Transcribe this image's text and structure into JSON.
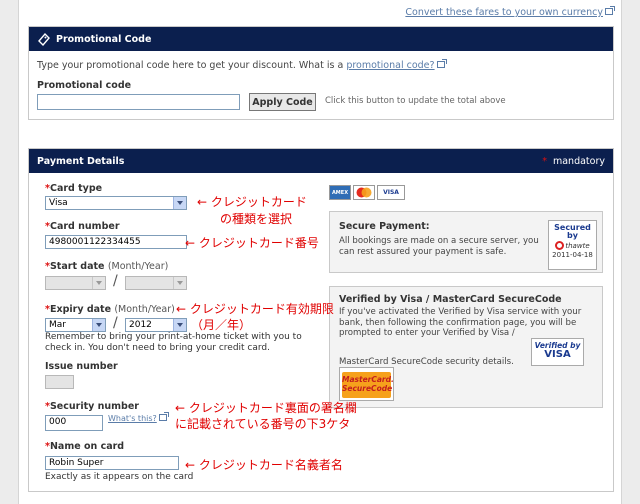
{
  "top_link": "Convert these fares to your own currency",
  "promo": {
    "title": "Promotional Code",
    "intro": "Type your promotional code here to get your discount. What is a",
    "intro_link": "promotional code?",
    "field_label": "Promotional code",
    "field_value": "",
    "apply_button": "Apply Code",
    "hint": "Click this button to update the total above"
  },
  "payment": {
    "title": "Payment Details",
    "mandatory_star": "*",
    "mandatory": "mandatory",
    "req_star": "*",
    "card_type_label": "Card type",
    "card_type_value": "Visa",
    "card_number_label": "Card number",
    "card_number_value": "4980001122334455",
    "start_date_label": "Start date",
    "start_date_hint": "(Month/Year)",
    "start_month": "",
    "start_year": "",
    "date_sep": "/",
    "expiry_label": "Expiry date",
    "expiry_hint": "(Month/Year)",
    "expiry_month": "Mar",
    "expiry_year": "2012",
    "reminder": "Remember to bring your print-at-home ticket with you to check in. You don't need to bring your credit card.",
    "issue_label": "Issue number",
    "issue_value": "",
    "security_label": "Security number",
    "security_value": "000",
    "whats_this": "What's this?",
    "name_label": "Name on card",
    "name_value": "Robin Super",
    "name_hint": "Exactly as it appears on the card",
    "card_logos": [
      "AMEX",
      "MC",
      "VISA"
    ]
  },
  "secure": {
    "title": "Secure Payment:",
    "text": "All bookings are made on a secure server, you can rest assured your payment is safe.",
    "badge_line1": "Secured",
    "badge_line2": "by",
    "badge_brand": "thawte",
    "badge_date": "2011-04-18"
  },
  "verified": {
    "title": "Verified by Visa / MasterCard SecureCode",
    "text": "If you've activated the Verified by Visa service with your bank, then following the confirmation page, you will be prompted to enter your Verified by Visa /",
    "text2": "MasterCard SecureCode security details.",
    "vbv_line1": "Verified by",
    "vbv_line2": "VISA",
    "msc_line1": "MasterCard.",
    "msc_line2": "SecureCode"
  },
  "annotations": {
    "card_type": "← クレジットカード",
    "card_type2": "の種類を選択",
    "card_number": "← クレジットカード番号",
    "expiry": "← クレジットカード有効期限",
    "expiry2": "（月／年）",
    "security": "← クレジットカード裏面の署名欄",
    "security2": "に記載されている番号の下3ケタ",
    "name": "← クレジットカード名義者名"
  },
  "colors": {
    "header_bg": "#0b1f4e",
    "required": "#dd1111",
    "annotation": "#e00000",
    "link": "#5a7ca8"
  }
}
